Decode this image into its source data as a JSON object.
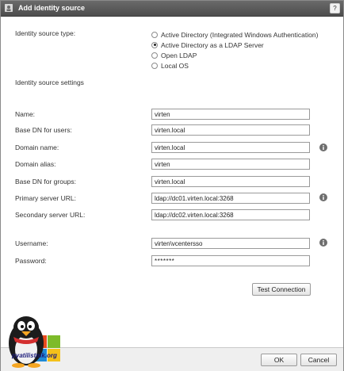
{
  "dialog": {
    "title": "Add identity source",
    "help": "?"
  },
  "identity_source_type": {
    "label": "Identity source type:",
    "options": [
      {
        "label": "Active Directory (Integrated Windows Authentication)",
        "checked": false
      },
      {
        "label": "Active Directory as a LDAP Server",
        "checked": true
      },
      {
        "label": "Open LDAP",
        "checked": false
      },
      {
        "label": "Local OS",
        "checked": false
      }
    ]
  },
  "settings_heading": "Identity source settings",
  "fields": {
    "name": {
      "label": "Name:",
      "value": "virten"
    },
    "base_dn_users": {
      "label": "Base DN for users:",
      "value": "virten.local"
    },
    "domain_name": {
      "label": "Domain name:",
      "value": "virten.local"
    },
    "domain_alias": {
      "label": "Domain alias:",
      "value": "virten"
    },
    "base_dn_groups": {
      "label": "Base DN for groups:",
      "value": "virten.local"
    },
    "primary_url": {
      "label": "Primary server URL:",
      "value": "ldap://dc01.virten.local:3268"
    },
    "secondary_url": {
      "label": "Secondary server URL:",
      "value": "ldap://dc02.virten.local:3268"
    },
    "username": {
      "label": "Username:",
      "value": "virten\\vcentersso"
    },
    "password": {
      "label": "Password:",
      "value": "*******"
    }
  },
  "buttons": {
    "test_connection": "Test Connection",
    "ok": "OK",
    "cancel": "Cancel"
  },
  "watermark": "pyatilistnik.org",
  "icons": {
    "title": "identity-source-icon",
    "info": "info-icon",
    "logo": "penguin-logo"
  }
}
